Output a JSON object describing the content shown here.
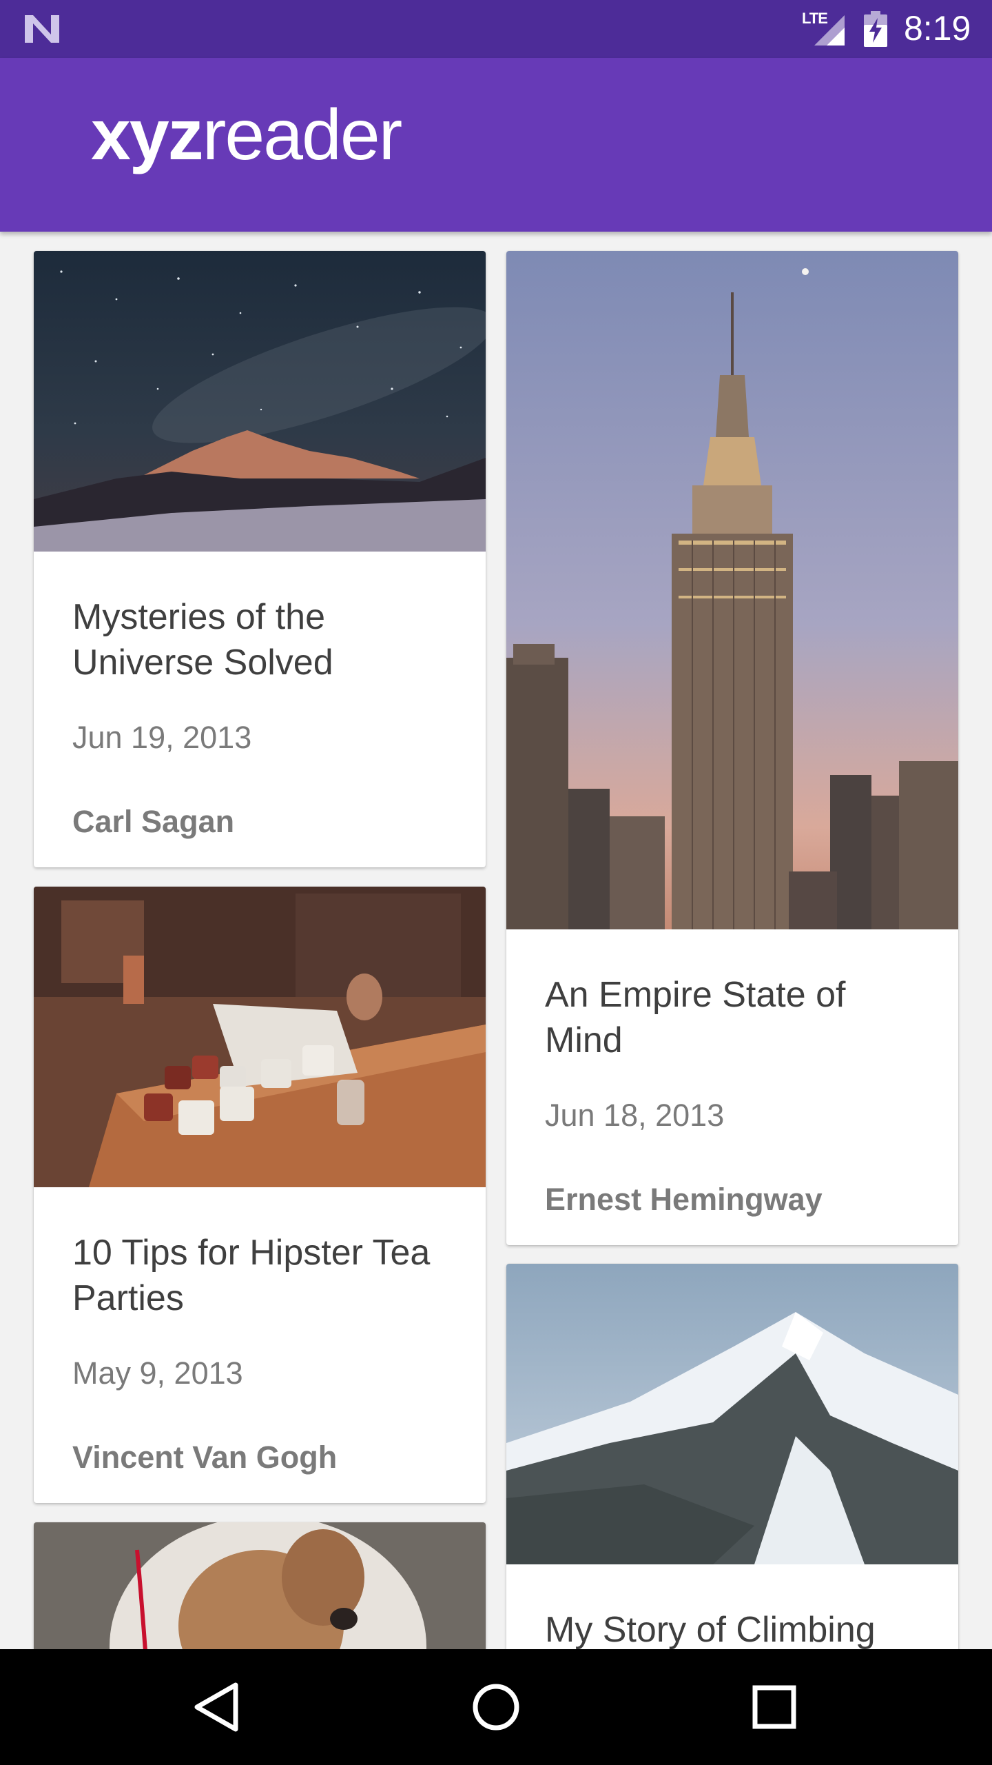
{
  "status_bar": {
    "network": "LTE",
    "time": "8:19",
    "icons": [
      "notification-n-icon",
      "signal-icon",
      "battery-charging-icon"
    ]
  },
  "app_bar": {
    "logo_bold": "xyz",
    "logo_regular": "reader",
    "color": "#673ab7"
  },
  "articles": [
    {
      "title": "Mysteries of the Universe Solved",
      "date": "Jun 19, 2013",
      "author": "Carl Sagan",
      "image": "night-sky-mountain"
    },
    {
      "title": "An Empire State of Mind",
      "date": "Jun 18, 2013",
      "author": "Ernest Hemingway",
      "image": "empire-state-building"
    },
    {
      "title": "10 Tips for Hipster Tea Parties",
      "date": "May 9, 2013",
      "author": "Vincent Van Gogh",
      "image": "tea-cups-table"
    },
    {
      "title": "My Story of Climbing",
      "image": "snowy-mountain"
    },
    {
      "image": "bulldog"
    }
  ],
  "nav_bar": {
    "icons": [
      "back-icon",
      "home-icon",
      "recents-icon"
    ]
  }
}
